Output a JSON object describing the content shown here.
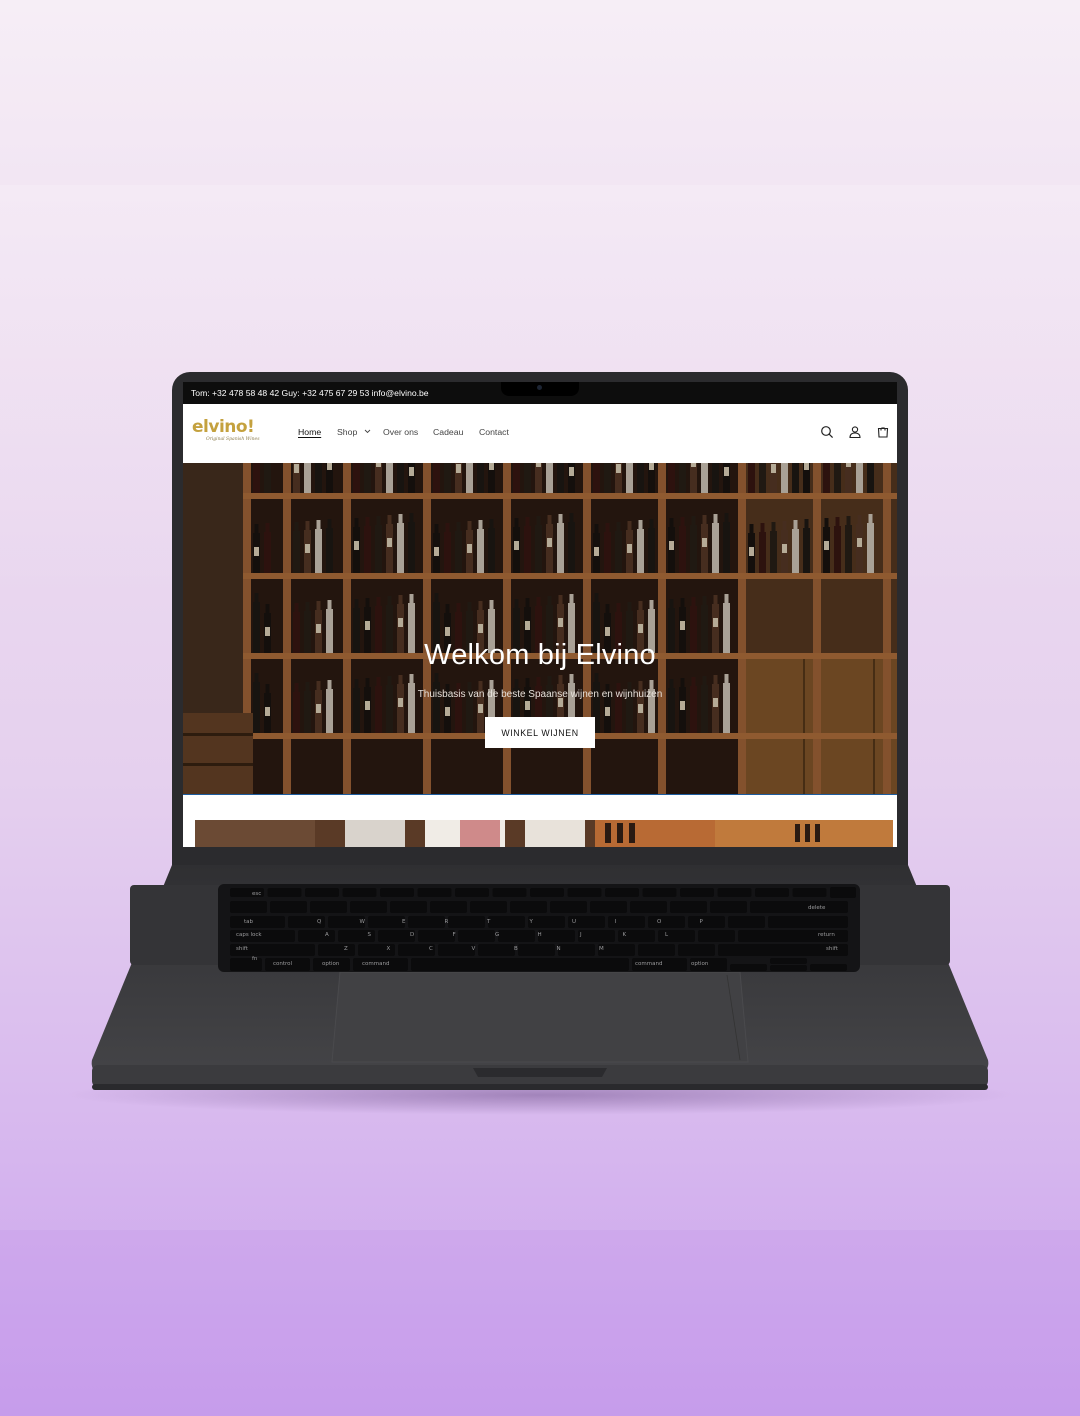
{
  "browser_page": {
    "topbar": {
      "contact": "Tom: +32 478 58 48 42 Guy: +32 475 67 29 53 info@elvino.be"
    },
    "logo": {
      "name": "elvino!",
      "tagline": "Original Spanish Wines"
    },
    "nav": {
      "home": "Home",
      "shop": "Shop",
      "about": "Over ons",
      "gift": "Cadeau",
      "contact": "Contact"
    },
    "header_icons": [
      "search-icon",
      "account-icon",
      "cart-icon"
    ],
    "hero": {
      "title": "Welkom bij Elvino",
      "subtitle": "Thuisbasis van de beste Spaanse wijnen en wijnhuizen",
      "button": "WINKEL WIJNEN"
    }
  },
  "keyboard": {
    "keys": {
      "esc": "esc",
      "delete": "delete",
      "tab": "tab",
      "caps": "caps lock",
      "return": "return",
      "shift_left": "shift",
      "shift_right": "shift",
      "fn": "fn",
      "control": "control",
      "option_left": "option",
      "command_left": "command",
      "command_right": "command",
      "option_right": "option"
    },
    "row_letters": {
      "q": [
        "Q",
        "W",
        "E",
        "R",
        "T",
        "Y",
        "U",
        "I",
        "O",
        "P"
      ],
      "a": [
        "A",
        "S",
        "D",
        "F",
        "G",
        "H",
        "J",
        "K",
        "L"
      ],
      "z": [
        "Z",
        "X",
        "C",
        "V",
        "B",
        "N",
        "M"
      ]
    }
  },
  "colors": {
    "brand_gold": "#c4a13e",
    "topbar_bg": "#0d0d0d",
    "laptop_body": "#3b3b3e",
    "accent_line": "#1d5c9e"
  }
}
